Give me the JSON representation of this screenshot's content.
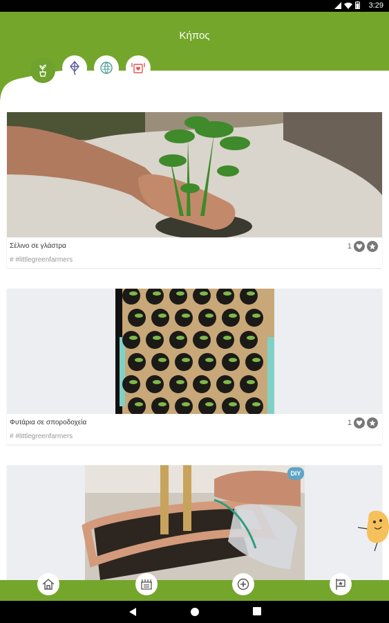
{
  "status_bar": {
    "time": "3:29"
  },
  "header": {
    "title": "Κήπος"
  },
  "tabs": [
    {
      "icon": "plant-pot-icon",
      "active": true
    },
    {
      "icon": "kite-icon",
      "active": false
    },
    {
      "icon": "recycle-globe-icon",
      "active": false
    },
    {
      "icon": "food-icon",
      "active": false
    }
  ],
  "cards": [
    {
      "caption": "Σέλινο σε γλάστρα",
      "tag": "# #littlegreenfarmers",
      "likes": "1"
    },
    {
      "caption": "Φυτάρια σε σποροδοχεία",
      "tag": "# #littlegreenfarmers",
      "likes": "1"
    },
    {
      "badge": "DIY"
    }
  ],
  "bottom_nav": [
    {
      "icon": "home-icon"
    },
    {
      "icon": "market-icon"
    },
    {
      "icon": "add-icon"
    },
    {
      "icon": "flag-icon"
    }
  ],
  "colors": {
    "brand_green": "#74a62c",
    "tab_active": "#6fa22e"
  }
}
